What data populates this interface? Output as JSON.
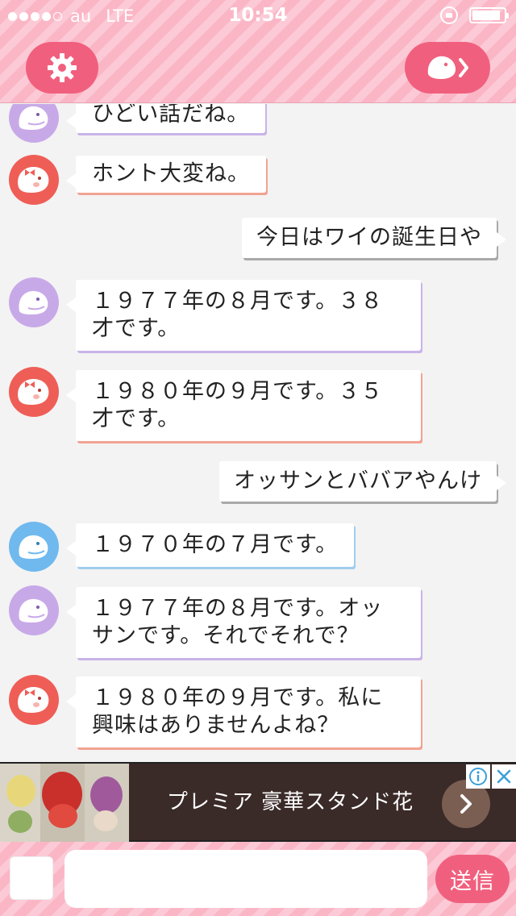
{
  "status_bar": {
    "carrier": "au",
    "network": "LTE",
    "time": "10:54",
    "signal_bars_filled": 4,
    "signal_bars_total": 5,
    "battery_level": 0.9,
    "icons": [
      "rotation-lock-icon",
      "battery-icon"
    ]
  },
  "header": {
    "settings_icon": "gear-icon",
    "next_icon": "character-arrow-icon"
  },
  "colors": {
    "header_pink": "#fbb6c6",
    "button_pink": "#f0607e",
    "avatar_purple": "#c8a9e8",
    "avatar_red": "#ee5e57",
    "avatar_blue": "#6fb9ee"
  },
  "messages": [
    {
      "side": "left",
      "avatar": "purple-character-avatar",
      "text": "ひどい話だね。"
    },
    {
      "side": "left",
      "avatar": "red-character-avatar",
      "text": "ホント大変ね。"
    },
    {
      "side": "right",
      "text": "今日はワイの誕生日や"
    },
    {
      "side": "left",
      "avatar": "purple-character-avatar",
      "text": "１９７７年の８月です。３８才です。"
    },
    {
      "side": "left",
      "avatar": "red-character-avatar",
      "text": "１９８０年の９月です。３５才です。"
    },
    {
      "side": "right",
      "text": "オッサンとババアやんけ"
    },
    {
      "side": "left",
      "avatar": "blue-character-avatar",
      "text": "１９７０年の７月です。"
    },
    {
      "side": "left",
      "avatar": "purple-character-avatar",
      "text": "１９７７年の８月です。オッサンです。それでそれで？"
    },
    {
      "side": "left",
      "avatar": "red-character-avatar",
      "text": "１９８０年の９月です。私に興味はありませんよね？"
    }
  ],
  "ad": {
    "text": "プレミア 豪華スタンド花",
    "arrow_icon": "chevron-right-icon",
    "info_icon": "info-icon",
    "close_icon": "close-icon"
  },
  "input_bar": {
    "message_value": "",
    "send_label": "送信"
  }
}
